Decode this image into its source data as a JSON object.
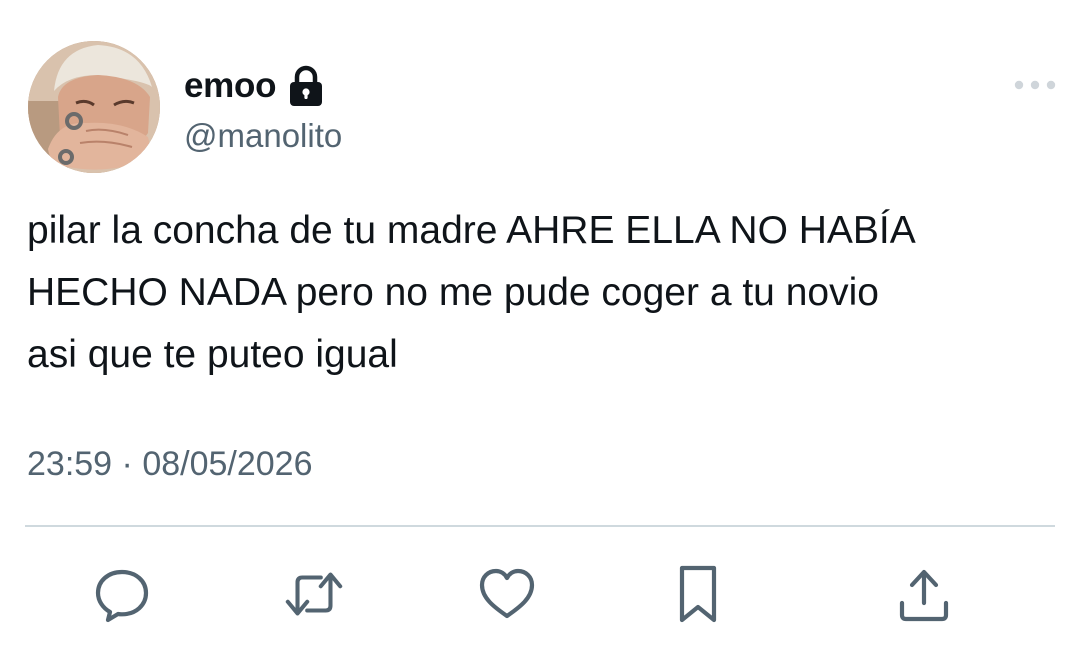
{
  "user": {
    "display_name": "emoo",
    "handle": "@manolito",
    "protected": true,
    "avatar_icon": "profile-photo"
  },
  "tweet": {
    "text": "pilar la concha de tu madre AHRE ELLA NO HABÍA\nHECHO NADA pero no me pude coger a tu novio\nasi que te puteo igual",
    "time": "23:59",
    "separator": "·",
    "date": "08/05/2026"
  },
  "actions": [
    {
      "name": "reply",
      "icon": "speech-bubble-icon"
    },
    {
      "name": "retweet",
      "icon": "retweet-arrows-icon"
    },
    {
      "name": "like",
      "icon": "heart-icon"
    },
    {
      "name": "bookmark",
      "icon": "bookmark-icon"
    },
    {
      "name": "share",
      "icon": "share-upload-icon"
    }
  ],
  "colors": {
    "text": "#0f1419",
    "secondary": "#536471",
    "divider": "#cfd9de",
    "icons": "#536471"
  }
}
